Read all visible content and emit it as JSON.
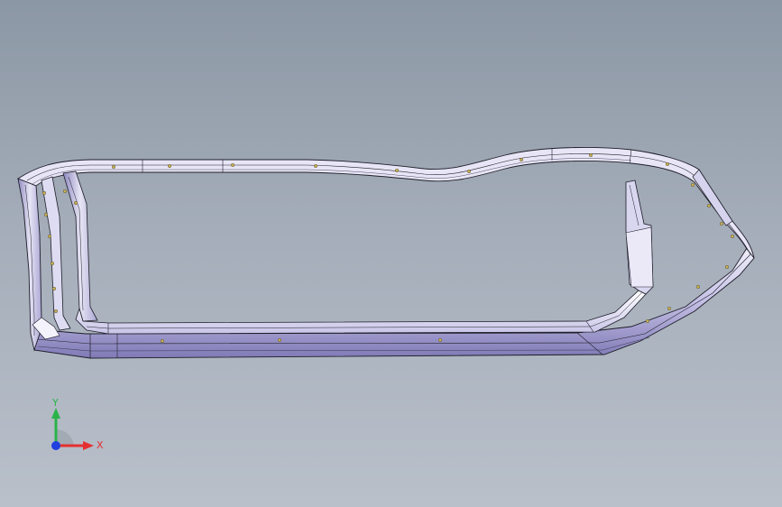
{
  "viewport": {
    "background_top": "#8c97a5",
    "background_bottom": "#b9c0ca"
  },
  "model": {
    "edge_color": "#1e1e28",
    "face_light": "#e6e4f4",
    "face_mid": "#c5c2e6",
    "face_dark": "#8d88c2",
    "fastener_color": "#c9b255"
  },
  "triad": {
    "x_label": "X",
    "y_label": "Y",
    "x_color": "#e53030",
    "y_color": "#2bb34a",
    "z_color": "#2040e0"
  }
}
